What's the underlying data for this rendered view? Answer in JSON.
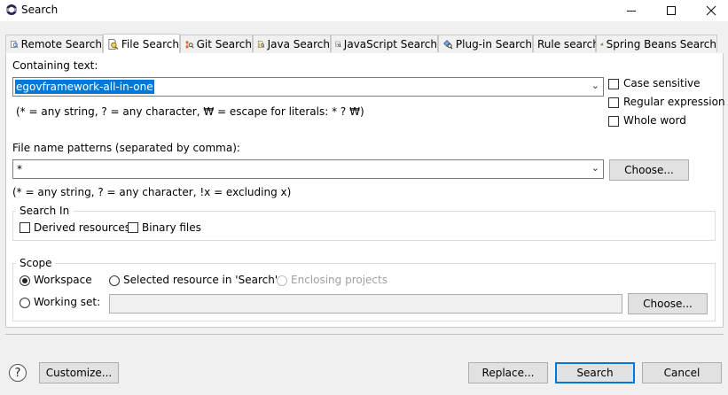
{
  "window": {
    "title": "Search",
    "minimize_icon": "minimize-icon",
    "maximize_icon": "maximize-icon",
    "close_icon": "close-icon"
  },
  "tabs": [
    {
      "label": "Remote Search",
      "icon": "remote-search-icon"
    },
    {
      "label": "File Search",
      "icon": "file-search-icon",
      "active": true
    },
    {
      "label": "Git Search",
      "icon": "git-search-icon"
    },
    {
      "label": "Java Search",
      "icon": "java-search-icon"
    },
    {
      "label": "JavaScript Search",
      "icon": "javascript-search-icon"
    },
    {
      "label": "Plug-in Search",
      "icon": "plugin-search-icon"
    },
    {
      "label": "Rule search"
    },
    {
      "label": "Spring Beans Search",
      "icon": "spring-beans-icon"
    }
  ],
  "containing_text": {
    "label": "Containing text:",
    "value": "egovframework-all-in-one",
    "hint": "(* = any string, ? = any character, ₩ = escape for literals: * ? ₩)"
  },
  "options": {
    "case_sensitive": {
      "label": "Case sensitive",
      "checked": false
    },
    "regular_expression": {
      "label": "Regular expression",
      "checked": false
    },
    "whole_word": {
      "label": "Whole word",
      "checked": false
    }
  },
  "file_patterns": {
    "label": "File name patterns (separated by comma):",
    "value": "*",
    "choose_label": "Choose...",
    "hint": "(* = any string, ? = any character, !x = excluding x)"
  },
  "search_in": {
    "title": "Search In",
    "derived": {
      "label": "Derived resources",
      "checked": false
    },
    "binary": {
      "label": "Binary files",
      "checked": false
    }
  },
  "scope": {
    "title": "Scope",
    "workspace": {
      "label": "Workspace",
      "selected": true
    },
    "selected_resource": {
      "label": "Selected resource in 'Search'",
      "selected": false
    },
    "enclosing_projects": {
      "label": "Enclosing projects",
      "selected": false,
      "enabled": false
    },
    "working_set": {
      "label": "Working set:",
      "selected": false,
      "value": ""
    },
    "choose_label": "Choose..."
  },
  "footer": {
    "help_icon": "help-icon",
    "customize_label": "Customize...",
    "replace_label": "Replace...",
    "search_label": "Search",
    "cancel_label": "Cancel"
  }
}
